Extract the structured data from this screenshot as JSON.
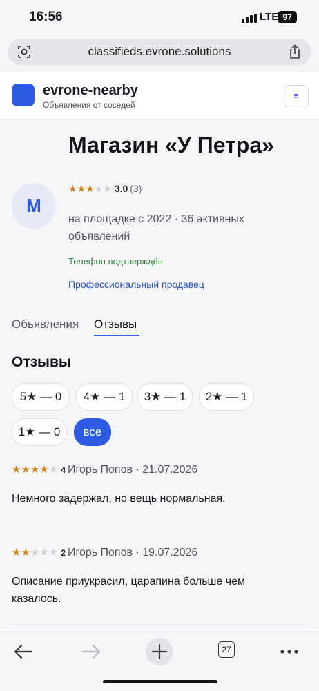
{
  "status": {
    "time": "16:56",
    "network": "LTE",
    "battery": "97"
  },
  "browser": {
    "url": "classifieds.evrone.solutions",
    "tabs_count": "27"
  },
  "site": {
    "brand": "evrone-nearby",
    "tagline": "Объявления от соседей",
    "menu_icon": "≡"
  },
  "seller": {
    "name": "Магазин «У Петра»",
    "avatar_letter": "M",
    "rating_value": 3,
    "rating": "3.0",
    "rating_count": "(3)",
    "meta": "на площадке с 2022 · 36 активных объявлений",
    "verified": "Телефон подтверждён",
    "professional": "Профессиональный продавец"
  },
  "tabs": [
    {
      "label": "Обьявления",
      "active": false
    },
    {
      "label": "Отзывы",
      "active": true
    }
  ],
  "reviews_section": {
    "title": "Отзывы",
    "filters": [
      {
        "label": "5★ — 0",
        "active": false
      },
      {
        "label": "4★ — 1",
        "active": false
      },
      {
        "label": "3★ — 1",
        "active": false
      },
      {
        "label": "2★ — 1",
        "active": false
      },
      {
        "label": "1★ — 0",
        "active": false
      },
      {
        "label": "все",
        "active": true
      }
    ],
    "reviews": [
      {
        "stars": 4,
        "rating": "4",
        "author_date": "Игорь Попов · 21.07.2026",
        "text": "Немного задержал, но вещь нормальная."
      },
      {
        "stars": 2,
        "rating": "2",
        "author_date": "Игорь Попов · 19.07.2026",
        "text": "Описание приукрасил, царапина больше чем казалось."
      }
    ]
  },
  "colors": {
    "accent": "#2d5ce3",
    "star": "#c8861c",
    "verified": "#2a8a3c",
    "pro_link": "#2752c4"
  }
}
